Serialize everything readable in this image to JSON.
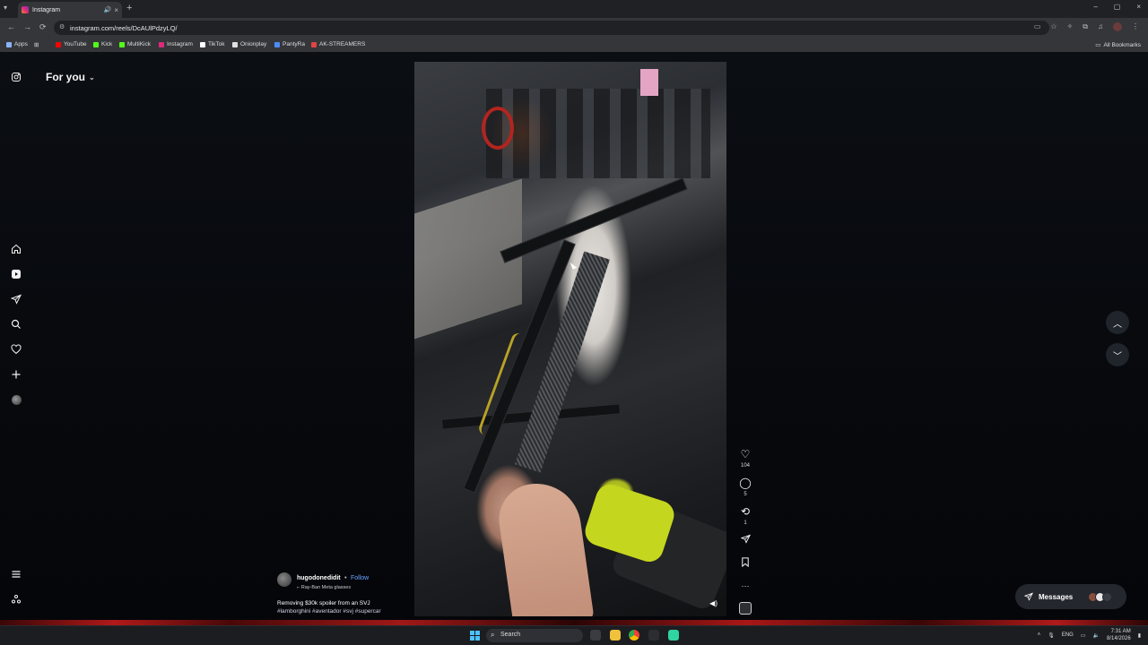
{
  "browser": {
    "tab_title": "Instagram",
    "tab_close": "×",
    "new_tab": "+",
    "url": "instagram.com/reels/DcAUlPdzyLQ/",
    "window_controls": [
      "–",
      "▢",
      "×"
    ],
    "bookmarks": [
      {
        "label": "Apps",
        "color": "#8ab4f8"
      },
      {
        "label": "YouTube",
        "color": "#ff0000"
      },
      {
        "label": "Kick",
        "color": "#53fc18"
      },
      {
        "label": "MultiKick",
        "color": "#53fc18"
      },
      {
        "label": "Instagram",
        "color": "#dd2a7b"
      },
      {
        "label": "TikTok",
        "color": "#ffffff"
      },
      {
        "label": "Onionplay",
        "color": "#e0e0e0"
      },
      {
        "label": "PantyRa",
        "color": "#4d8cff"
      },
      {
        "label": "AK-STREAMERS",
        "color": "#e04444"
      }
    ],
    "all_bookmarks": "All Bookmarks"
  },
  "instagram": {
    "feed_title": "For you",
    "left_nav": [
      "instagram-logo-icon",
      "home-icon",
      "reels-icon",
      "direct-icon",
      "search-icon",
      "heart-icon",
      "create-icon",
      "profile-avatar",
      "menu-icon",
      "meta-icon"
    ],
    "reel": {
      "username": "hugodonedidit",
      "separator": "•",
      "follow_label": "Follow",
      "music": "Ray-Ban Meta glasses",
      "caption": "Removing $30k spoiler from an SVJ",
      "hashtags": "#lamborghini #aventador #svj #supercar",
      "likes": "104",
      "comments": "5",
      "reposts": "1",
      "more": "···"
    },
    "messages_label": "Messages"
  },
  "taskbar": {
    "search_placeholder": "Search",
    "lang": "ENG",
    "time": "7:31 AM",
    "date": "8/14/2026"
  },
  "colors": {
    "accent_link": "#6aa3ff",
    "page_bg": "#07090d",
    "glow": "#b0191a"
  }
}
